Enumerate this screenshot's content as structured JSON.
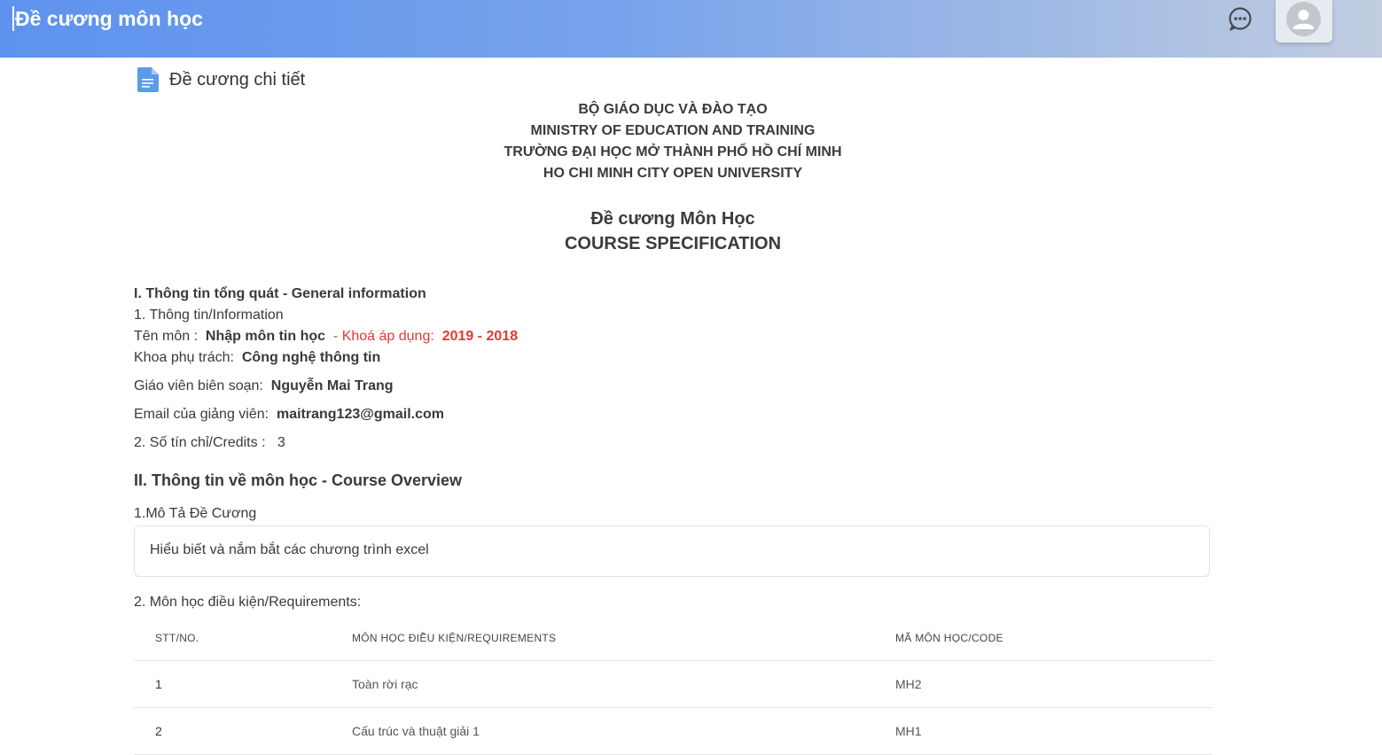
{
  "header": {
    "title": "Đề cương môn học",
    "chat_icon": "chat-bubble-icon",
    "avatar_icon": "user-avatar-icon"
  },
  "section": {
    "icon": "document-icon",
    "title": "Đề cương chi tiết"
  },
  "institution": {
    "line1": "BỘ GIÁO DỤC VÀ ĐÀO TẠO",
    "line2": "MINISTRY OF EDUCATION AND TRAINING",
    "line3": "TRƯỜNG ĐẠI HỌC MỞ THÀNH PHỐ HỒ CHÍ MINH",
    "line4": "HO CHI MINH CITY OPEN UNIVERSITY"
  },
  "spec": {
    "title_vi": "Đề cương Môn Học",
    "title_en": "COURSE SPECIFICATION"
  },
  "general": {
    "heading": "I. Thông tin tổng quát - General information",
    "info_heading": "1. Thông tin/Information",
    "course_name_label": "Tên môn :",
    "course_name": "Nhập môn tin học",
    "cohort_label": "- Khoá áp dụng:",
    "cohort": "2019 - 2018",
    "faculty_label": "Khoa phụ trách:",
    "faculty": "Công nghệ thông tin",
    "teacher_label": "Giáo viên biên soạn:",
    "teacher": "Nguyễn Mai Trang",
    "email_label": "Email của giảng viên:",
    "email": "maitrang123@gmail.com",
    "credits_label": "2. Số tín chỉ/Credits :",
    "credits": "3"
  },
  "overview": {
    "heading": "II. Thông tin về môn học - Course Overview",
    "desc_heading": "1.Mô Tả Đề Cương",
    "description": "Hiểu biết và nắm bắt các chương trình excel",
    "req_heading": "2. Môn học điều kiện/Requirements:"
  },
  "requirements": {
    "columns": [
      "STT/NO.",
      "MÔN HỌC ĐIỀU KIỆN/REQUIREMENTS",
      "MÃ MÔN HỌC/CODE"
    ],
    "rows": [
      [
        "1",
        "Toàn rời rạc",
        "MH2"
      ],
      [
        "2",
        "Cấu trúc và thuật giải 1",
        "MH1"
      ]
    ]
  },
  "colors": {
    "header_gradient_start": "#5d92ee",
    "header_gradient_end": "#c2cde0",
    "accent_red": "#e53935",
    "doc_icon": "#5c9be6"
  }
}
